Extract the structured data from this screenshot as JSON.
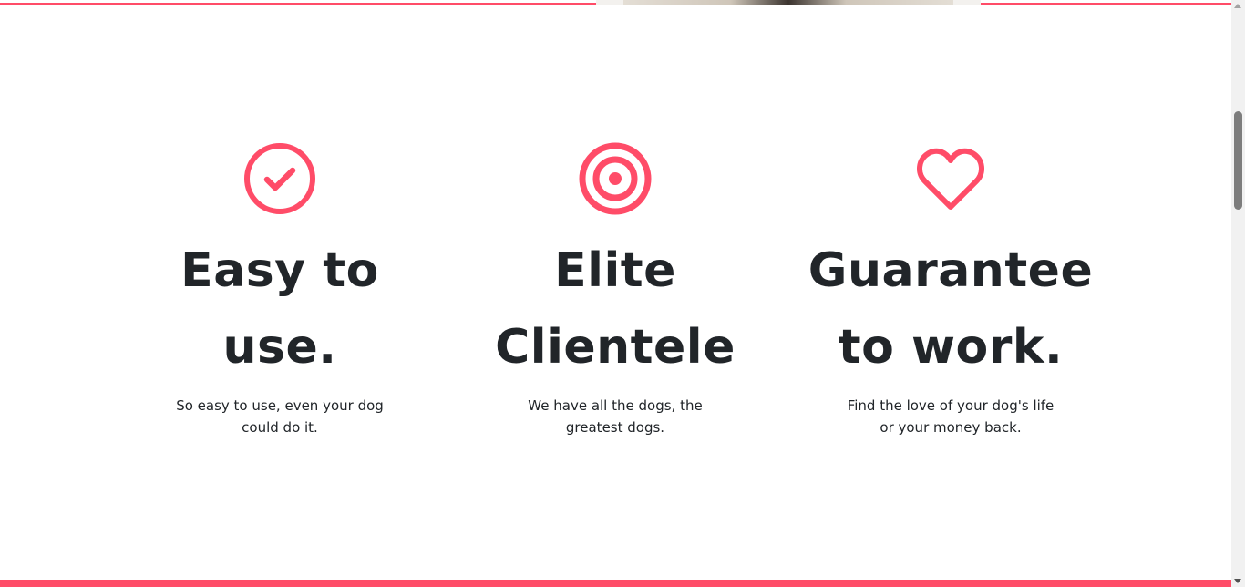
{
  "colors": {
    "accent": "#ff4c68",
    "heading": "#212529",
    "background": "#ffffff"
  },
  "features": [
    {
      "icon": "circle-check-icon",
      "title_line1": "Easy to",
      "title_line2": "use.",
      "desc_line1": "So easy to use, even your dog",
      "desc_line2": "could do it."
    },
    {
      "icon": "bullseye-icon",
      "title_line1": "Elite",
      "title_line2": "Clientele",
      "desc_line1": "We have all the dogs, the",
      "desc_line2": "greatest dogs."
    },
    {
      "icon": "heart-icon",
      "title_line1": "Guarantee",
      "title_line2": "to work.",
      "desc_line1": "Find the love of your dog's life",
      "desc_line2": "or your money back."
    }
  ]
}
